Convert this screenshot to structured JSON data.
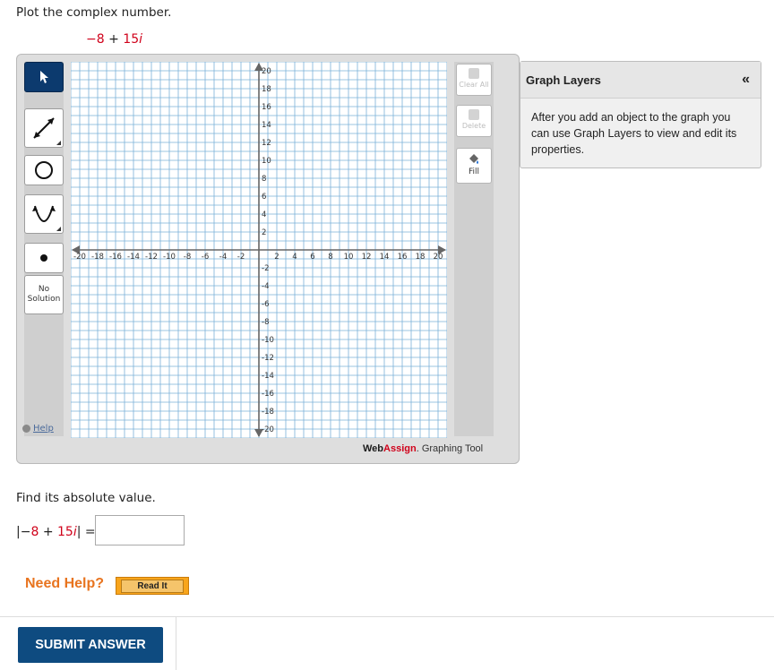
{
  "question1": {
    "text": "Plot the complex number."
  },
  "expr": {
    "real": "−8",
    "op": " + ",
    "imag_coef": "15",
    "imag_unit": "i"
  },
  "graph_tool": {
    "tools": {
      "no_solution_line1": "No",
      "no_solution_line2": "Solution"
    },
    "help_label": "Help",
    "right_buttons": {
      "clear_all": "Clear All",
      "delete": "Delete",
      "fill": "Fill"
    },
    "brand": {
      "web": "Web",
      "assign": "Assign",
      "suffix": ". Graphing Tool"
    },
    "axes": {
      "x_ticks": [
        "-20",
        "-18",
        "-16",
        "-14",
        "-12",
        "-10",
        "-8",
        "-6",
        "-4",
        "-2",
        "2",
        "4",
        "6",
        "8",
        "10",
        "12",
        "14",
        "16",
        "18",
        "20"
      ],
      "y_ticks": [
        "20",
        "18",
        "16",
        "14",
        "12",
        "10",
        "8",
        "6",
        "4",
        "2",
        "-2",
        "-4",
        "-6",
        "-8",
        "-10",
        "-12",
        "-14",
        "-16",
        "-18",
        "-20"
      ],
      "range": [
        -21,
        21
      ]
    }
  },
  "graph_layers": {
    "title": "Graph Layers",
    "collapse_icon": "«",
    "body": "After you add an object to the graph you can use Graph Layers to view and edit its properties."
  },
  "question2": {
    "text": "Find its absolute value."
  },
  "abs_expr": {
    "open": "|−",
    "real": "8",
    "op": " + ",
    "imag_coef": "15",
    "imag_unit": "i",
    "close": "| ="
  },
  "answer_input": {
    "value": ""
  },
  "need_help": {
    "label": "Need Help?",
    "read_it": "Read It"
  },
  "submit": {
    "label": "SUBMIT ANSWER"
  },
  "colors": {
    "accent_red": "#d0021b",
    "submit_blue": "#0e4b80",
    "help_orange": "#e8741f",
    "grid_blue": "#7ab0d8"
  }
}
